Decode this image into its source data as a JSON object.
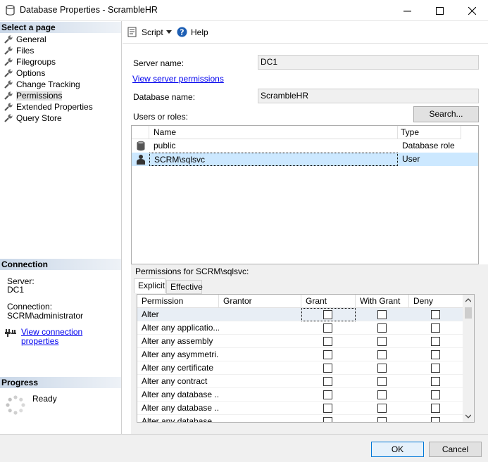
{
  "window": {
    "title": "Database Properties - ScrambleHR"
  },
  "left": {
    "select_page_header": "Select a page",
    "pages": [
      {
        "label": "General"
      },
      {
        "label": "Files"
      },
      {
        "label": "Filegroups"
      },
      {
        "label": "Options"
      },
      {
        "label": "Change Tracking"
      },
      {
        "label": "Permissions",
        "selected": true
      },
      {
        "label": "Extended Properties"
      },
      {
        "label": "Query Store"
      }
    ],
    "connection_header": "Connection",
    "server_label": "Server:",
    "server_value": "DC1",
    "connection_label": "Connection:",
    "connection_value": "SCRM\\administrator",
    "view_connection_link": "View connection properties",
    "progress_header": "Progress",
    "progress_status": "Ready"
  },
  "toolbar": {
    "script_label": "Script",
    "help_label": "Help"
  },
  "form": {
    "server_name_label": "Server name:",
    "server_name_value": "DC1",
    "view_server_permissions_link": "View server permissions",
    "database_name_label": "Database name:",
    "database_name_value": "ScrambleHR",
    "users_or_roles_label": "Users or roles:",
    "search_button": "Search..."
  },
  "users_grid": {
    "columns": [
      "Name",
      "Type"
    ],
    "rows": [
      {
        "name": "public",
        "type": "Database role",
        "icon": "database-role-icon"
      },
      {
        "name": "SCRM\\sqlsvc",
        "type": "User",
        "icon": "user-icon",
        "selected": true
      }
    ]
  },
  "permissions": {
    "label": "Permissions for SCRM\\sqlsvc:",
    "tabs": [
      {
        "label": "Explicit",
        "active": true
      },
      {
        "label": "Effective"
      }
    ],
    "columns": [
      "Permission",
      "Grantor",
      "Grant",
      "With Grant",
      "Deny"
    ],
    "rows": [
      {
        "permission": "Alter",
        "grantor": "",
        "grant": false,
        "with_grant": false,
        "deny": false
      },
      {
        "permission": "Alter any applicatio...",
        "grantor": "",
        "grant": false,
        "with_grant": false,
        "deny": false
      },
      {
        "permission": "Alter any assembly",
        "grantor": "",
        "grant": false,
        "with_grant": false,
        "deny": false
      },
      {
        "permission": "Alter any asymmetri...",
        "grantor": "",
        "grant": false,
        "with_grant": false,
        "deny": false
      },
      {
        "permission": "Alter any certificate",
        "grantor": "",
        "grant": false,
        "with_grant": false,
        "deny": false
      },
      {
        "permission": "Alter any contract",
        "grantor": "",
        "grant": false,
        "with_grant": false,
        "deny": false
      },
      {
        "permission": "Alter any database ...",
        "grantor": "",
        "grant": false,
        "with_grant": false,
        "deny": false
      },
      {
        "permission": "Alter any database ...",
        "grantor": "",
        "grant": false,
        "with_grant": false,
        "deny": false
      },
      {
        "permission": "Alter any database ...",
        "grantor": "",
        "grant": false,
        "with_grant": false,
        "deny": false
      }
    ]
  },
  "buttons": {
    "ok": "OK",
    "cancel": "Cancel"
  },
  "colors": {
    "selection": "#cce8ff",
    "link": "#0000ee",
    "header_gradient_start": "#c9d7e8"
  }
}
